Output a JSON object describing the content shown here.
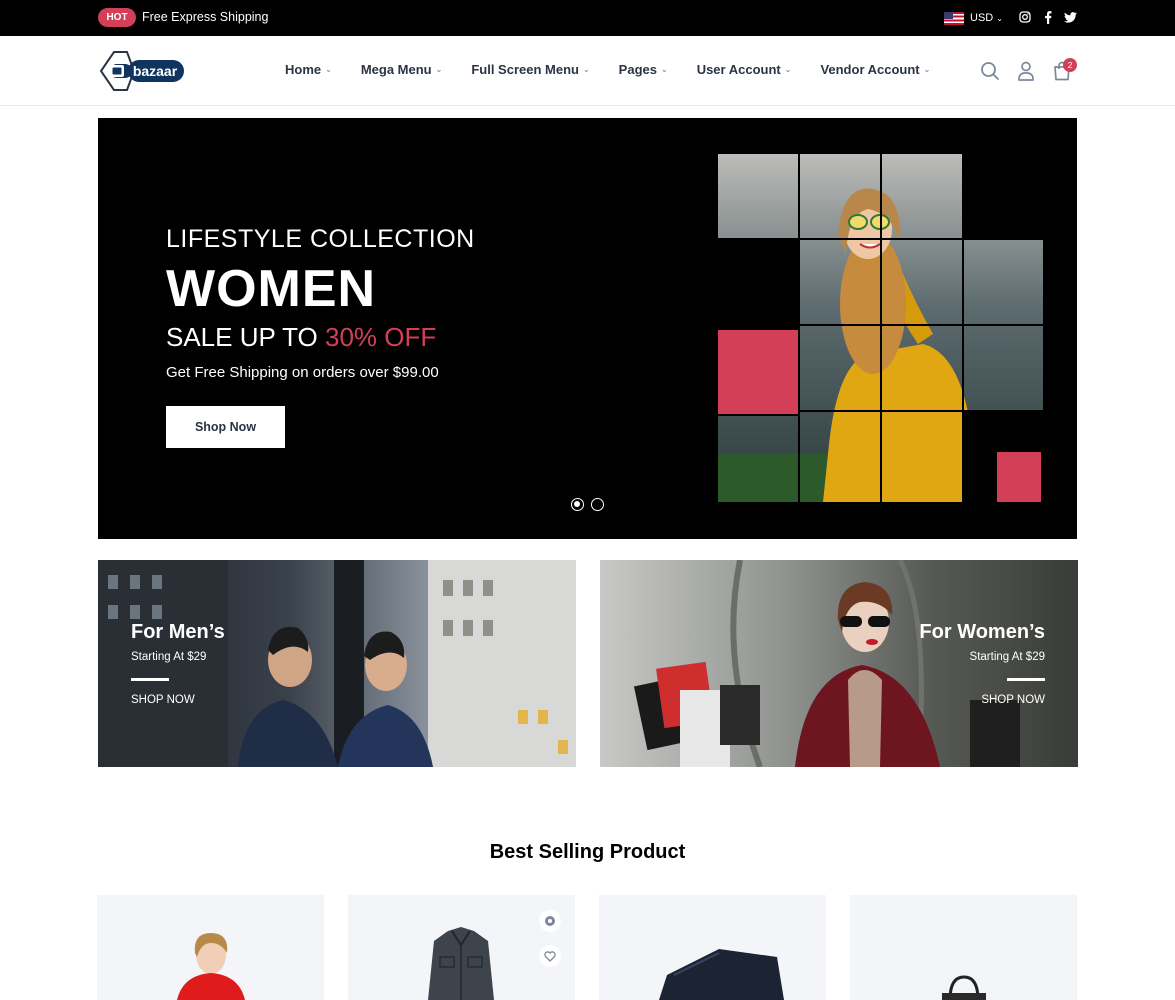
{
  "topbar": {
    "badge": "HOT",
    "promo_text": "Free Express Shipping",
    "currency": "USD",
    "social": [
      "instagram-icon",
      "facebook-icon",
      "twitter-icon"
    ]
  },
  "header": {
    "logo_text": "bazaar",
    "nav": [
      {
        "label": "Home"
      },
      {
        "label": "Mega Menu"
      },
      {
        "label": "Full Screen Menu"
      },
      {
        "label": "Pages"
      },
      {
        "label": "User Account"
      },
      {
        "label": "Vendor Account"
      }
    ],
    "cart_count": "2"
  },
  "hero": {
    "eyebrow": "LIFESTYLE COLLECTION",
    "title": "WOMEN",
    "sale_prefix": "SALE UP TO ",
    "sale_highlight": "30% OFF",
    "shipping": "Get Free Shipping on orders over $99.00",
    "button": "Shop Now",
    "slides": 2,
    "active_slide": 1
  },
  "banners": [
    {
      "title": "For Men’s",
      "subtitle": "Starting At $29",
      "link": "SHOP NOW"
    },
    {
      "title": "For Women’s",
      "subtitle": "Starting At $29",
      "link": "SHOP NOW"
    }
  ],
  "best_selling": {
    "title": "Best Selling Product",
    "products": [
      {
        "icon": "red-jacket-model-image"
      },
      {
        "icon": "denim-jacket-image"
      },
      {
        "icon": "jeans-image"
      },
      {
        "icon": "handbag-image"
      }
    ]
  },
  "colors": {
    "accent": "#d23f57",
    "dark": "#000000",
    "text": "#2b3445",
    "card_bg": "#f3f5f9"
  }
}
